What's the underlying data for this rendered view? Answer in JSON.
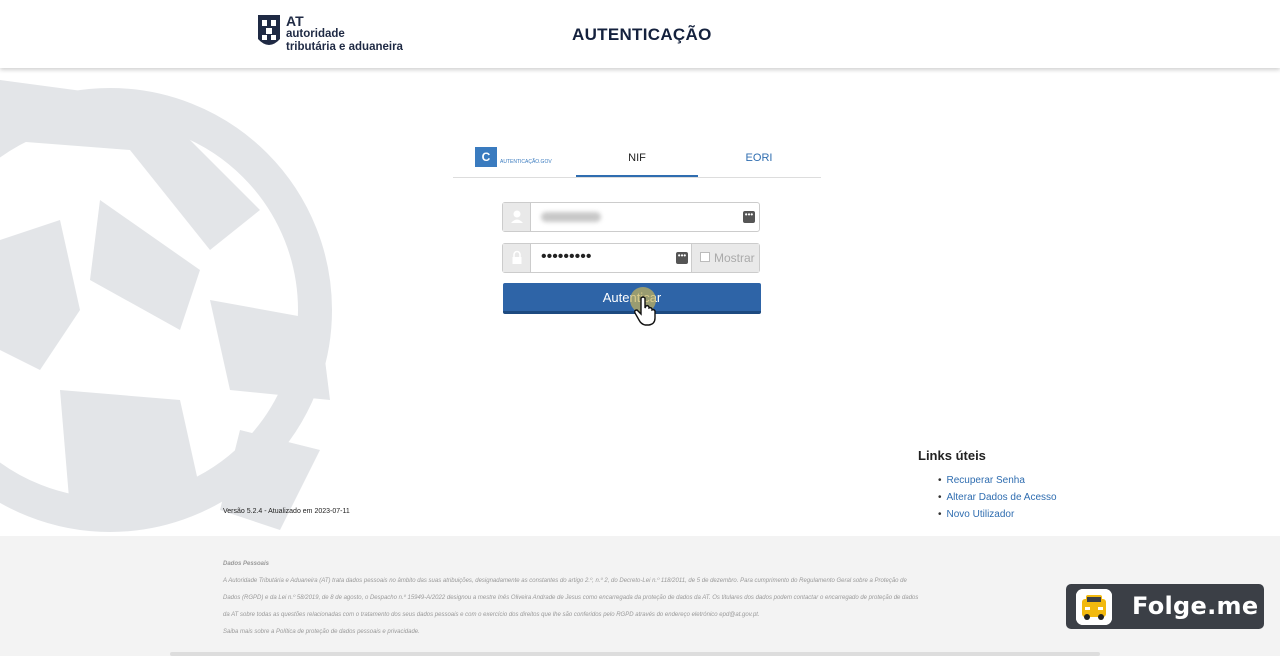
{
  "header": {
    "logo_at": "AT",
    "logo_line1": "autoridade",
    "logo_line2": "tributária e aduaneira",
    "title": "AUTENTICAÇÃO"
  },
  "tabs": [
    {
      "label": "AUTENTICAÇÃO.GOV",
      "active": false
    },
    {
      "label": "NIF",
      "active": true
    },
    {
      "label": "EORI",
      "active": false
    }
  ],
  "form": {
    "password_value": "•••••••••",
    "show_label": "Mostrar",
    "submit_label": "Autenticar"
  },
  "links": {
    "title": "Links úteis",
    "items": [
      "Recuperar Senha",
      "Alterar Dados de Acesso",
      "Novo Utilizador"
    ]
  },
  "version": "Versão 5.2.4 - Atualizado em 2023-07-11",
  "footer": {
    "heading": "Dados Pessoais",
    "line1": "A Autoridade Tributária e Aduaneira (AT) trata dados pessoais no âmbito das suas atribuições, designadamente as constantes do artigo 2.º, n.º 2, do Decreto-Lei n.º 118/2011, de 5 de dezembro. Para cumprimento do Regulamento Geral sobre a Proteção de",
    "line2": "Dados (RGPD) e da Lei n.º 58/2019, de 8 de agosto, o Despacho n.º 15949-A/2022 designou a mestre Inês Oliveira Andrade de Jesus como encarregada da proteção de dados da AT. Os titulares dos dados podem contactar o encarregado de proteção de dados",
    "line3": "da AT sobre todas as questões relacionadas com o tratamento dos seus dados pessoais e com o exercício dos direitos que lhe são conferidos pelo RGPD através do endereço eletrónico epd@at.gov.pt.",
    "line4": "Saiba mais sobre a Política de proteção de dados pessoais e privacidade."
  },
  "badge": {
    "label": "Folge.me"
  },
  "colors": {
    "primary": "#2e64a7",
    "link": "#2f6db0",
    "title": "#14213d"
  }
}
